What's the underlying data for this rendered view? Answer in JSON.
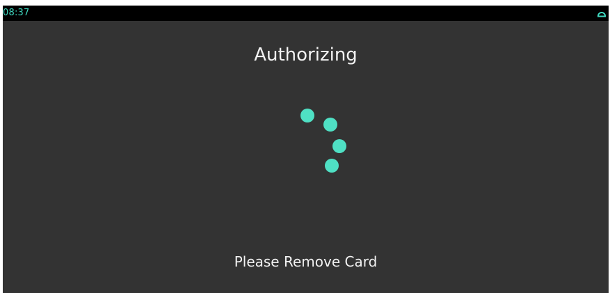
{
  "status_bar": {
    "time": "08:37",
    "icon": "cloud-icon"
  },
  "screen": {
    "title": "Authorizing",
    "message": "Please Remove Card"
  },
  "colors": {
    "accent": "#4fe0c4",
    "background": "#333333",
    "status_bar": "#000000",
    "text": "#f2f2f2"
  },
  "spinner": {
    "dot_count": 4
  }
}
